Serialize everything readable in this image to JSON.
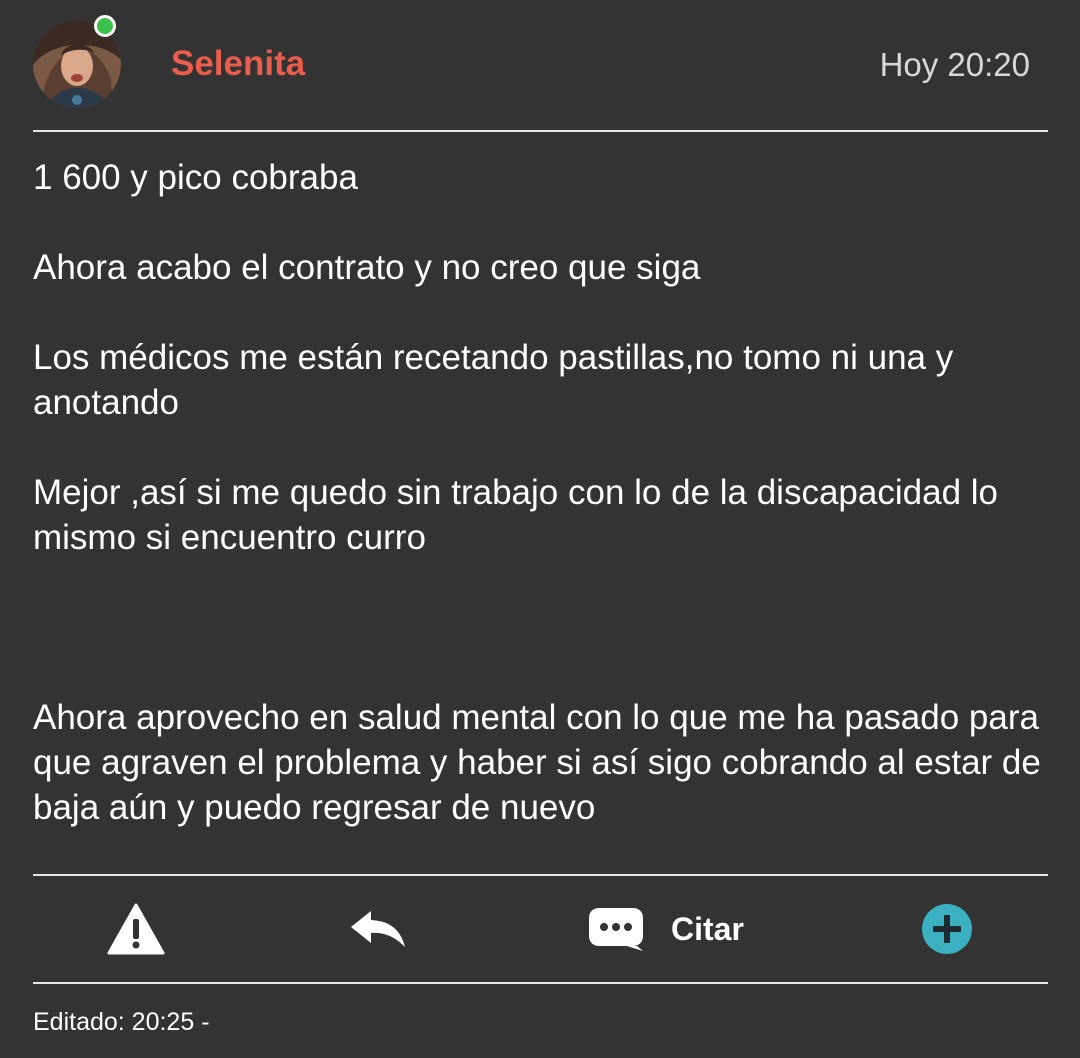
{
  "post": {
    "author": "Selenita",
    "timestamp": "Hoy 20:20",
    "author_online": true,
    "paragraphs": [
      "1 600 y pico cobraba",
      "Ahora acabo el contrato y no creo que siga",
      "Los médicos me están recetando pastillas,no tomo ni una y anotando",
      "Mejor ,así si me quedo sin trabajo con lo de la discapacidad lo mismo si encuentro curro",
      "Ahora aprovecho en salud mental con lo que me ha pasado para que agraven el problema y haber si así sigo cobrando al estar de baja aún y puedo regresar de nuevo"
    ],
    "edited": "Editado: 20:25 -"
  },
  "actions": {
    "report_icon": "warning-icon",
    "reply_icon": "reply-icon",
    "quote_icon": "chat-bubble-icon",
    "quote_label": "Citar",
    "more_icon": "plus-circle-icon"
  },
  "colors": {
    "background": "#333333",
    "author": "#ea5c4b",
    "online": "#3cc24a",
    "accent": "#3ab0c0"
  }
}
